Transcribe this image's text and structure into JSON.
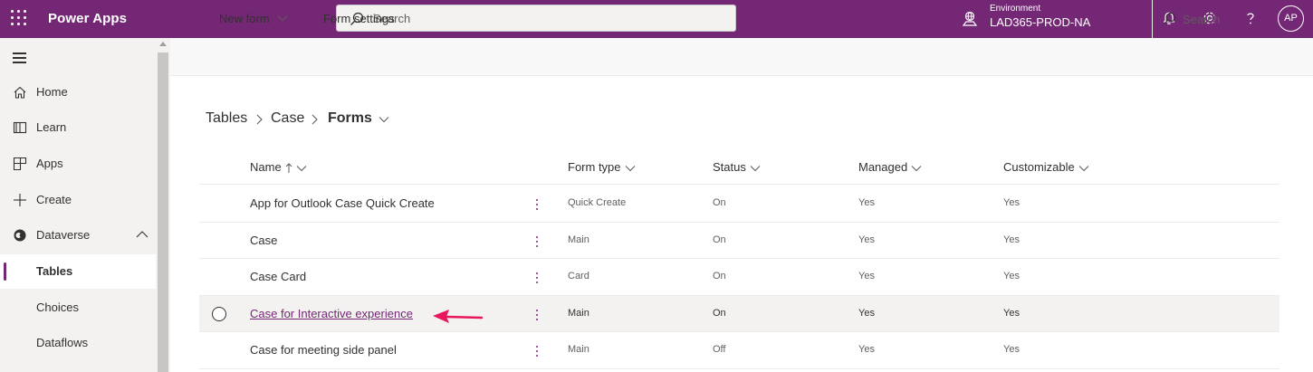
{
  "topbar": {
    "app_name": "Power Apps",
    "search_placeholder": "Search",
    "environment_label": "Environment",
    "environment_name": "LAD365-PROD-NA",
    "avatar_initials": "AP",
    "icons": [
      "waffle-icon",
      "search-icon",
      "environment-icon",
      "bell-icon",
      "gear-icon",
      "help-icon"
    ]
  },
  "sidebar": {
    "items": [
      {
        "label": "Home",
        "icon": "home-icon"
      },
      {
        "label": "Learn",
        "icon": "book-icon"
      },
      {
        "label": "Apps",
        "icon": "apps-icon"
      },
      {
        "label": "Create",
        "icon": "plus-icon"
      },
      {
        "label": "Dataverse",
        "icon": "dataverse-icon"
      },
      {
        "label": "Tables"
      },
      {
        "label": "Choices"
      },
      {
        "label": "Dataflows"
      }
    ],
    "selected": "Tables"
  },
  "commandbar": {
    "new_form": "New form",
    "form_settings": "Form settings",
    "search_placeholder": "Search"
  },
  "breadcrumb": {
    "items": [
      "Tables",
      "Case",
      "Forms"
    ]
  },
  "table": {
    "columns": [
      "Name",
      "Form type",
      "Status",
      "Managed",
      "Customizable"
    ],
    "rows": [
      {
        "name": "App for Outlook Case Quick Create",
        "form_type": "Quick Create",
        "status": "On",
        "managed": "Yes",
        "customizable": "Yes"
      },
      {
        "name": "Case",
        "form_type": "Main",
        "status": "On",
        "managed": "Yes",
        "customizable": "Yes"
      },
      {
        "name": "Case Card",
        "form_type": "Card",
        "status": "On",
        "managed": "Yes",
        "customizable": "Yes"
      },
      {
        "name": "Case for Interactive experience",
        "form_type": "Main",
        "status": "On",
        "managed": "Yes",
        "customizable": "Yes"
      },
      {
        "name": "Case for meeting side panel",
        "form_type": "Main",
        "status": "Off",
        "managed": "Yes",
        "customizable": "Yes"
      }
    ]
  },
  "colors": {
    "brand": "#742774",
    "annotation_arrow": "#e8175d"
  }
}
